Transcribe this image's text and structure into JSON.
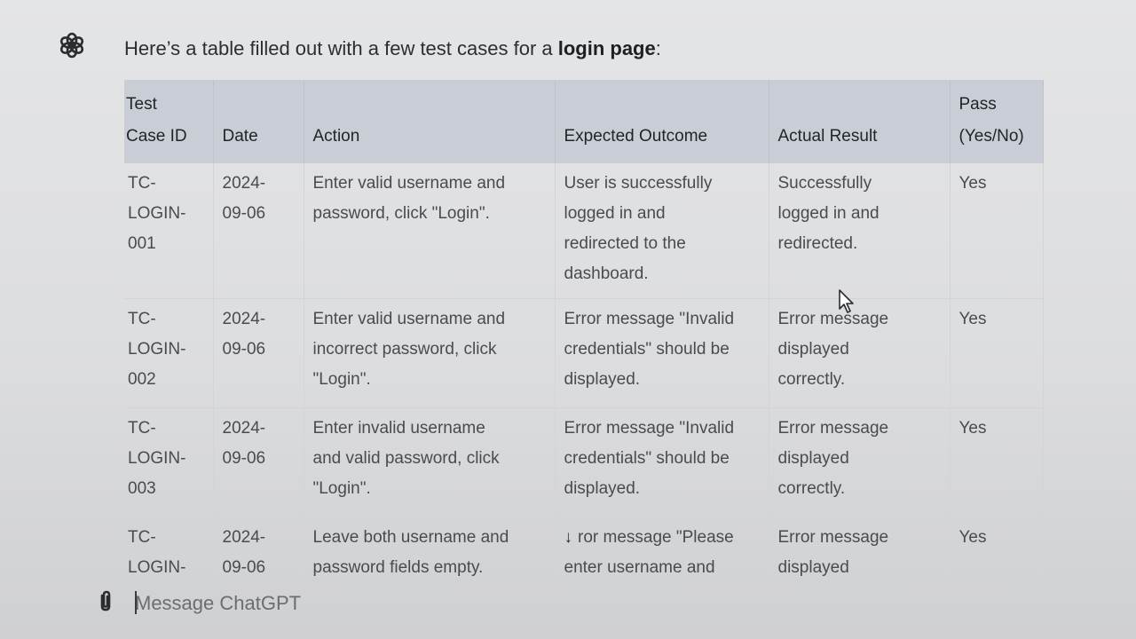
{
  "chat": {
    "intro_prefix": "Here’s a table filled out with a few test cases for a ",
    "intro_bold": "login page",
    "intro_suffix": ":"
  },
  "table": {
    "headers": {
      "test_case_id_line1": "Test",
      "test_case_id_line2": "Case ID",
      "date": "Date",
      "action": "Action",
      "expected_outcome": "Expected Outcome",
      "actual_result": "Actual Result",
      "pass_line1": "Pass",
      "pass_line2": "(Yes/No)"
    },
    "rows": [
      {
        "id_lines": [
          "TC-",
          "LOGIN-",
          "001"
        ],
        "date_lines": [
          "2024-",
          "09-06"
        ],
        "action_lines": [
          "Enter valid username and",
          "password, click \"Login\"."
        ],
        "expected_lines": [
          "User is successfully",
          "logged in and",
          "redirected to the",
          "dashboard."
        ],
        "actual_lines": [
          "Successfully",
          "logged in and",
          "redirected."
        ],
        "pass": "Yes"
      },
      {
        "id_lines": [
          "TC-",
          "LOGIN-",
          "002"
        ],
        "date_lines": [
          "2024-",
          "09-06"
        ],
        "action_lines": [
          "Enter valid username and",
          "incorrect password, click",
          "\"Login\"."
        ],
        "expected_lines": [
          "Error message \"Invalid",
          "credentials\" should be",
          "displayed."
        ],
        "actual_lines": [
          "Error message",
          "displayed",
          "correctly."
        ],
        "pass": "Yes"
      },
      {
        "id_lines": [
          "TC-",
          "LOGIN-",
          "003"
        ],
        "date_lines": [
          "2024-",
          "09-06"
        ],
        "action_lines": [
          "Enter invalid username",
          "and valid password, click",
          "\"Login\"."
        ],
        "expected_lines": [
          "Error message \"Invalid",
          "credentials\" should be",
          "displayed."
        ],
        "actual_lines": [
          "Error message",
          "displayed",
          "correctly."
        ],
        "pass": "Yes"
      },
      {
        "id_lines": [
          "TC-",
          "LOGIN-"
        ],
        "date_lines": [
          "2024-",
          "09-06"
        ],
        "action_lines": [
          "Leave both username and",
          "password fields empty."
        ],
        "expected_lines": [
          "ror message \"Please",
          "enter username and"
        ],
        "actual_lines": [
          "Error message",
          "displayed"
        ],
        "pass": "Yes"
      }
    ]
  },
  "scroll_down_icon": "↓",
  "composer": {
    "placeholder": "Message ChatGPT"
  },
  "icons": {
    "assistant": "openai-logo-icon",
    "attach": "paperclip-icon",
    "cursor": "mouse-pointer-icon",
    "scroll": "arrow-down-icon"
  }
}
